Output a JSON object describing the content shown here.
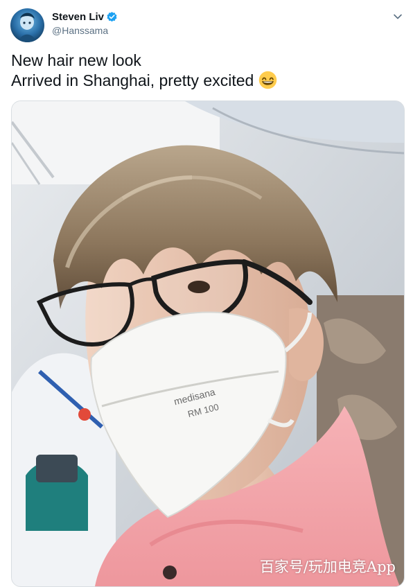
{
  "author": {
    "display_name": "Steven Liv",
    "handle": "@Hanssama",
    "verified_icon": "verified-badge-icon",
    "verified_color": "#1da1f2"
  },
  "menu": {
    "icon": "chevron-down-icon"
  },
  "tweet": {
    "line1": "New hair new look",
    "line2": "Arrived in Shanghai, pretty excited",
    "emoji": "grinning-face-icon"
  },
  "media": {
    "mask_brand": "medisana",
    "mask_model": "RM 100",
    "watermark": "百家号/玩加电竞App"
  },
  "colors": {
    "text": "#0f1419",
    "secondary": "#5b7083",
    "hoodie": "#f2a3a8"
  }
}
